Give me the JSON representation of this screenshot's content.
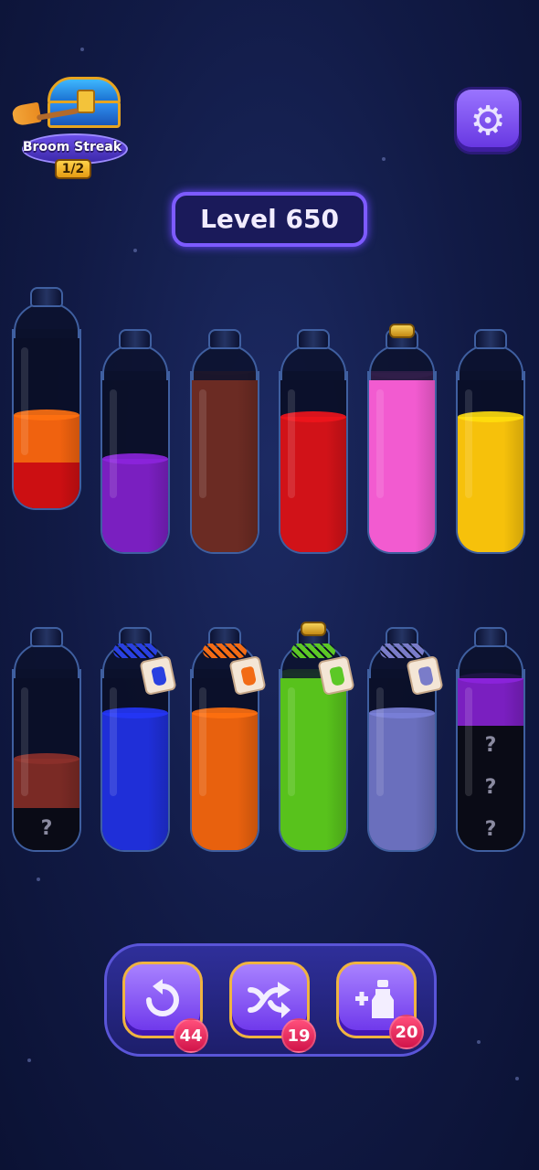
{
  "streak": {
    "label": "Broom Streak",
    "progress": "1/2"
  },
  "level": {
    "label": "Level 650"
  },
  "settings": {
    "icon": "gear-icon"
  },
  "bottles": {
    "row1": [
      {
        "layers": [
          "#cc0f12",
          "#f0620f"
        ],
        "hidden": 0,
        "cork": false
      },
      {
        "layers": [
          "#7a1fc0"
        ],
        "hidden": 0,
        "cork": false
      },
      {
        "layers": [
          "#6b2b23",
          "#6b2b23"
        ],
        "hidden": 0,
        "cork": false
      },
      {
        "layers": [
          "#d11218"
        ],
        "hidden": 0,
        "cork": false
      },
      {
        "layers": [
          "#f25bd0"
        ],
        "hidden": 0,
        "cork": true
      },
      {
        "layers": [
          "#f6c10b"
        ],
        "hidden": 0,
        "cork": false
      }
    ],
    "row2": [
      {
        "layers": [
          "#7a2a25"
        ],
        "hidden": 1,
        "tag": null
      },
      {
        "layers": [
          "#1f2fd8"
        ],
        "hidden": 0,
        "tag": "#2940e0"
      },
      {
        "layers": [
          "#e8610e"
        ],
        "hidden": 0,
        "tag": "#f26b15"
      },
      {
        "layers": [
          "#58c21c"
        ],
        "hidden": 0,
        "tag": "#5cc826",
        "cork": true
      },
      {
        "layers": [
          "#6a6fbd"
        ],
        "hidden": 0,
        "tag": "#7a7cc9"
      },
      {
        "layers": [
          "#7a1fc0"
        ],
        "hidden": 3,
        "tag": null
      }
    ],
    "hidden_symbol": "?"
  },
  "tools": {
    "undo": {
      "icon": "undo-icon",
      "count": "44"
    },
    "shuffle": {
      "icon": "shuffle-icon",
      "count": "19"
    },
    "add_bottle": {
      "icon": "add-bottle-icon",
      "count": "20"
    }
  }
}
